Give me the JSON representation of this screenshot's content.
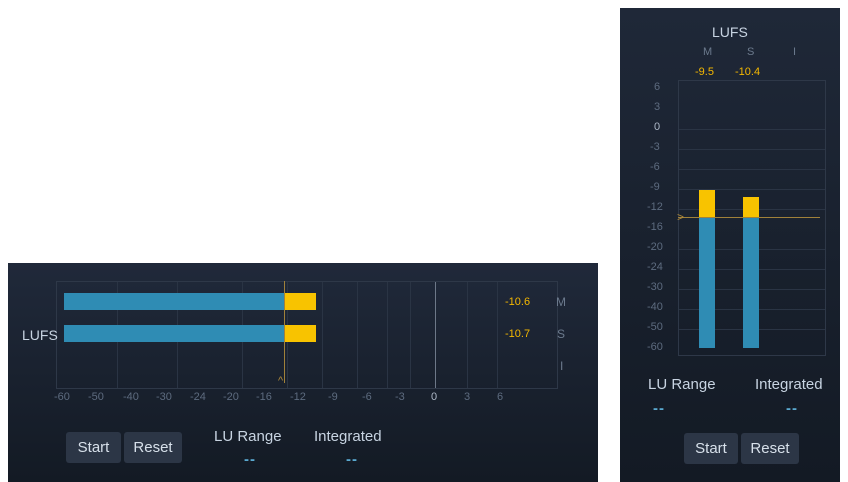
{
  "colors": {
    "accent_yellow": "#f8c300",
    "bar_blue": "#2f8cb4",
    "value_text": "#f5b800",
    "panel_bg": "#1a2230"
  },
  "horizontal_meter": {
    "title": "LUFS",
    "scale": [
      "-60",
      "-50",
      "-40",
      "-30",
      "-24",
      "-20",
      "-16",
      "-12",
      "-9",
      "-6",
      "-3",
      "0",
      "3",
      "6"
    ],
    "channels": [
      {
        "name": "M",
        "value": "-10.6"
      },
      {
        "name": "S",
        "value": "-10.7"
      },
      {
        "name": "I",
        "value": ""
      }
    ],
    "buttons": {
      "start": "Start",
      "reset": "Reset"
    },
    "lu_range": {
      "label": "LU Range",
      "value": "--"
    },
    "integrated": {
      "label": "Integrated",
      "value": "--"
    }
  },
  "vertical_meter": {
    "title": "LUFS",
    "channels": [
      {
        "name": "M",
        "value": "-9.5"
      },
      {
        "name": "S",
        "value": "-10.4"
      },
      {
        "name": "I",
        "value": ""
      }
    ],
    "scale": [
      "6",
      "3",
      "0",
      "-3",
      "-6",
      "-9",
      "-12",
      "-16",
      "-20",
      "-24",
      "-30",
      "-40",
      "-50",
      "-60"
    ],
    "lu_range": {
      "label": "LU Range",
      "value": "--"
    },
    "integrated": {
      "label": "Integrated",
      "value": "--"
    },
    "buttons": {
      "start": "Start",
      "reset": "Reset"
    }
  }
}
